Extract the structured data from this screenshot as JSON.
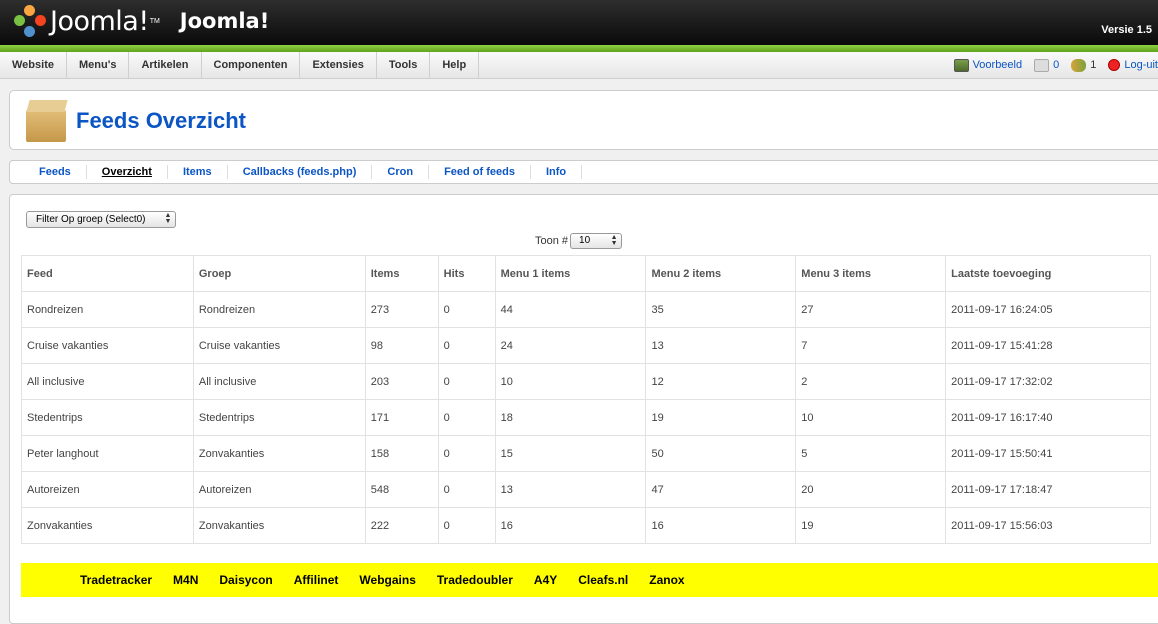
{
  "header": {
    "logo_text": "Joomla!",
    "logo_tm": "TM",
    "site_name": "Joomla!",
    "version": "Versie 1.5"
  },
  "menu": [
    "Website",
    "Menu's",
    "Artikelen",
    "Componenten",
    "Extensies",
    "Tools",
    "Help"
  ],
  "status": {
    "preview": "Voorbeeld",
    "messages": "0",
    "users": "1",
    "logout": "Log-uit"
  },
  "toolbar": {
    "title": "Feeds Overzicht"
  },
  "submenu": [
    "Feeds",
    "Overzicht",
    "Items",
    "Callbacks (feeds.php)",
    "Cron",
    "Feed of feeds",
    "Info"
  ],
  "filter": {
    "group_select": "Filter Op groep (Select0)",
    "toon_label": "Toon #",
    "toon_value": "10"
  },
  "table": {
    "headers": [
      "Feed",
      "Groep",
      "Items",
      "Hits",
      "Menu 1 items",
      "Menu 2 items",
      "Menu 3 items",
      "Laatste toevoeging"
    ],
    "rows": [
      [
        "Rondreizen",
        "Rondreizen",
        "273",
        "0",
        "44",
        "35",
        "27",
        "2011-09-17 16:24:05"
      ],
      [
        "Cruise vakanties",
        "Cruise vakanties",
        "98",
        "0",
        "24",
        "13",
        "7",
        "2011-09-17 15:41:28"
      ],
      [
        "All inclusive",
        "All inclusive",
        "203",
        "0",
        "10",
        "12",
        "2",
        "2011-09-17 17:32:02"
      ],
      [
        "Stedentrips",
        "Stedentrips",
        "171",
        "0",
        "18",
        "19",
        "10",
        "2011-09-17 16:17:40"
      ],
      [
        "Peter langhout",
        "Zonvakanties",
        "158",
        "0",
        "15",
        "50",
        "5",
        "2011-09-17 15:50:41"
      ],
      [
        "Autoreizen",
        "Autoreizen",
        "548",
        "0",
        "13",
        "47",
        "20",
        "2011-09-17 17:18:47"
      ],
      [
        "Zonvakanties",
        "Zonvakanties",
        "222",
        "0",
        "16",
        "16",
        "19",
        "2011-09-17 15:56:03"
      ]
    ]
  },
  "networks": [
    "Tradetracker",
    "M4N",
    "Daisycon",
    "Affilinet",
    "Webgains",
    "Tradedoubler",
    "A4Y",
    "Cleafs.nl",
    "Zanox"
  ],
  "colors": {
    "link": "#0b55c4",
    "green_bar": "#6cb52a",
    "network_bar": "#ffff00"
  }
}
